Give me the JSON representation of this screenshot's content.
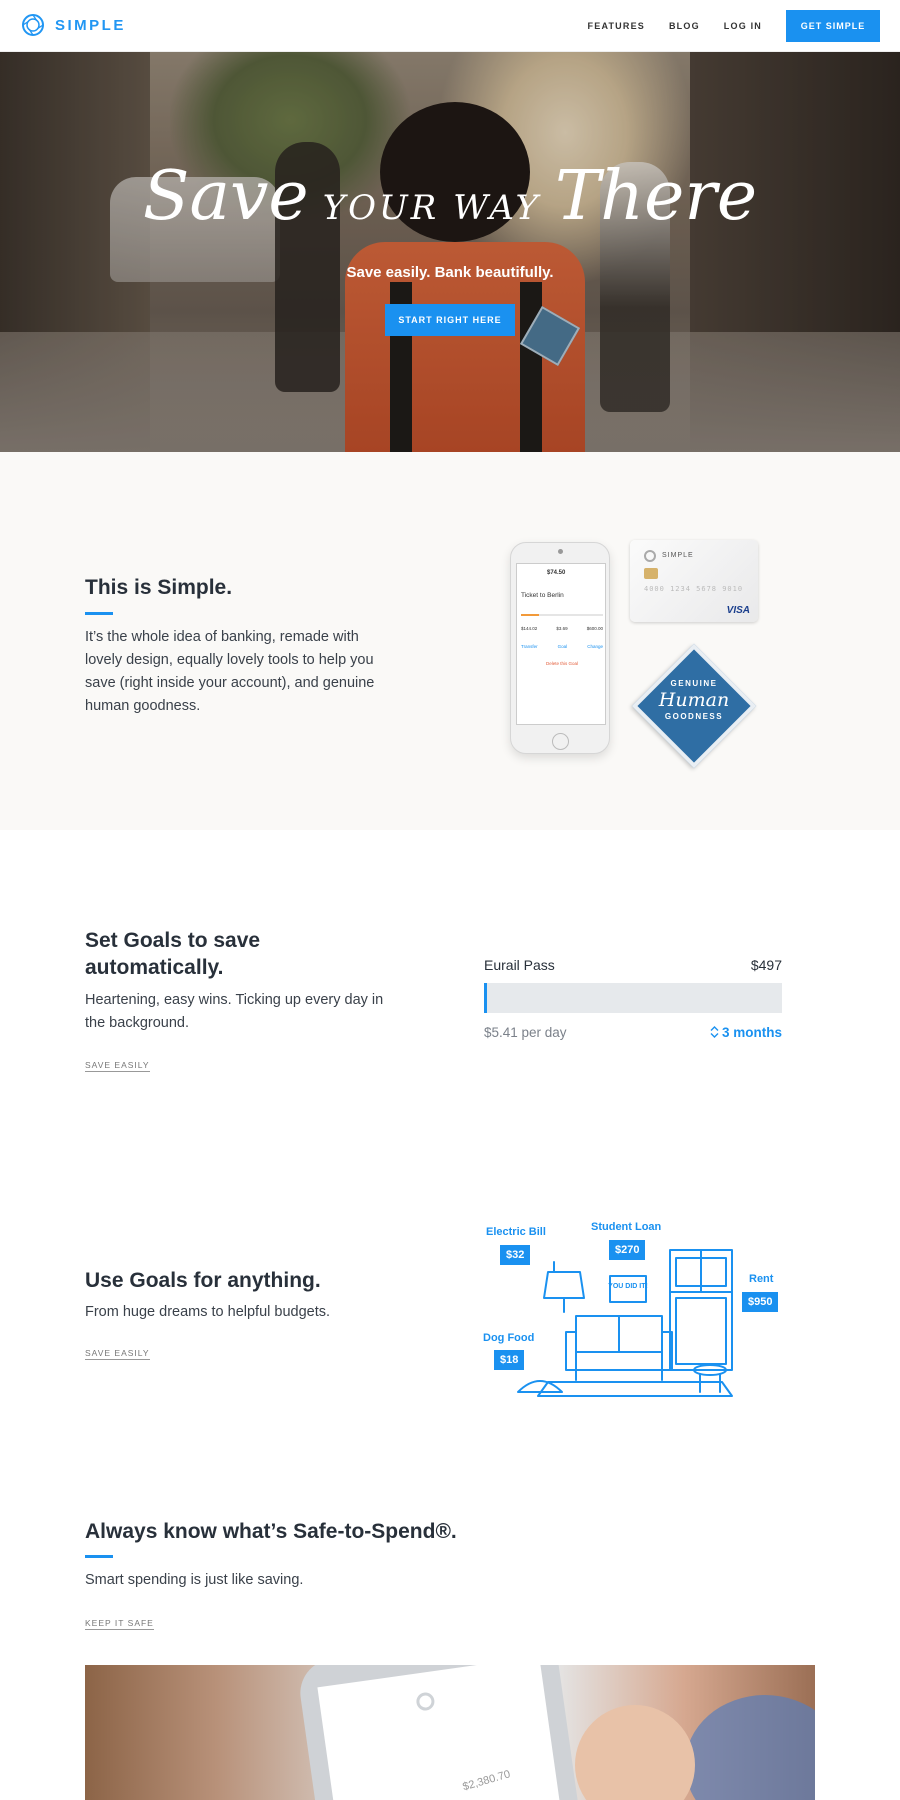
{
  "nav": {
    "brand": "SIMPLE",
    "links": [
      "FEATURES",
      "BLOG",
      "LOG IN"
    ],
    "cta": "GET SIMPLE"
  },
  "hero": {
    "title_save": "Save",
    "title_your_way": "YOUR WAY",
    "title_there": "There",
    "subtitle": "Save easily. Bank beautifully.",
    "button": "START RIGHT HERE"
  },
  "intro": {
    "heading": "This is Simple.",
    "body": "It’s the whole idea of banking, remade with lovely design, equally lovely tools to help you save (right inside your account), and genuine human goodness.",
    "phone": {
      "amount": "$74.50",
      "goal_title": "Ticket to Berlin",
      "progress": 0.22,
      "row_values": [
        "$144.02",
        "$3.69",
        "$600.00"
      ],
      "actions": [
        "Transfer",
        "Goal",
        "Change"
      ],
      "delete_label": "Delete this Goal"
    },
    "card": {
      "brand": "SIMPLE",
      "number": "4000 1234 5678 9010",
      "network": "VISA"
    },
    "patch": {
      "line1": "GENUINE",
      "line2": "Human",
      "line3": "GOODNESS"
    }
  },
  "goals": {
    "heading": "Set Goals to save automatically.",
    "body": "Heartening, easy wins. Ticking up every day in the background.",
    "link": "SAVE EASILY",
    "goal_name": "Eurail Pass",
    "goal_amount": "$497",
    "progress": 0.01,
    "per_day": "$5.41 per day",
    "duration": "3 months",
    "duration_icon": "chevron-up-down-icon"
  },
  "anything": {
    "heading": "Use Goals for anything.",
    "body": "From huge dreams to helpful budgets.",
    "link": "SAVE EASILY",
    "tags": [
      {
        "label": "Electric Bill",
        "value": "$32"
      },
      {
        "label": "Student Loan",
        "value": "$270"
      },
      {
        "label": "Rent",
        "value": "$950"
      },
      {
        "label": "Dog Food",
        "value": "$18"
      }
    ],
    "frame_text": "YOU DID IT!"
  },
  "safe": {
    "heading": "Always know what’s Safe-to-Spend®.",
    "body": "Smart spending is just like saving.",
    "link": "KEEP IT SAFE",
    "phone_amount": "$2,380.70"
  },
  "colors": {
    "accent": "#1a91f0",
    "text": "#28303a",
    "section_bg": "#faf9f7"
  }
}
